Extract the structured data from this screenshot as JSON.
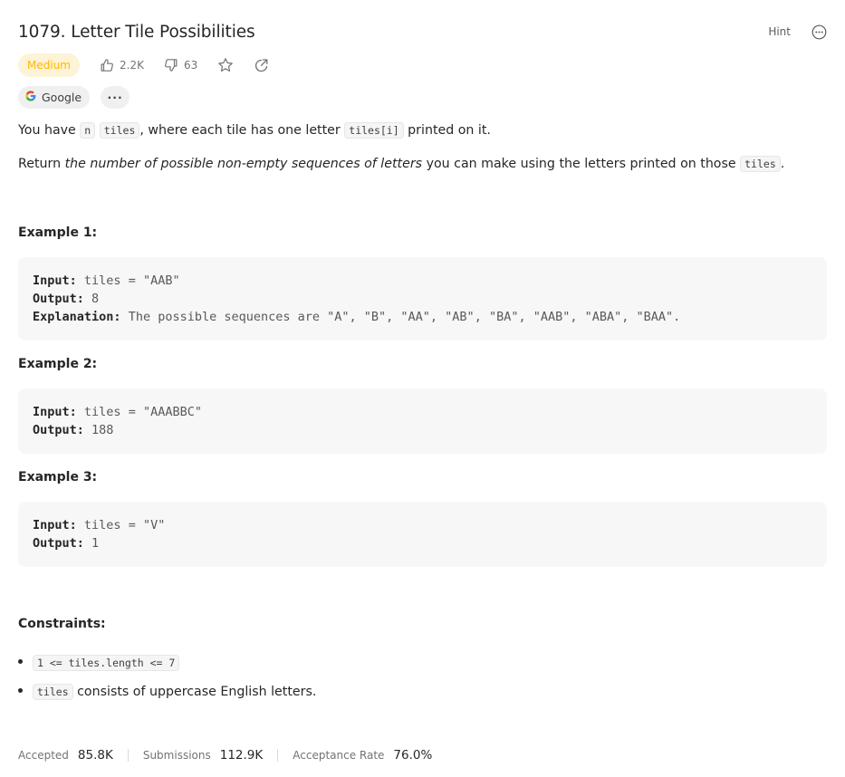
{
  "problem": {
    "title": "1079. Letter Tile Possibilities",
    "hint_label": "Hint",
    "difficulty": "Medium",
    "likes": "2.2K",
    "dislikes": "63",
    "company_tag": "Google",
    "more_tags": "···"
  },
  "description": {
    "p1": {
      "t1": "You have ",
      "c1": "n",
      "c2": "tiles",
      "t2": ", where each tile has one letter ",
      "c3": "tiles[i]",
      "t3": " printed on it."
    },
    "p2": {
      "t1": "Return ",
      "em": "the number of possible non-empty sequences of letters",
      "t2": " you can make using the letters printed on those ",
      "c1": "tiles",
      "t3": "."
    }
  },
  "examples": [
    {
      "heading": "Example 1:",
      "input_label": "Input:",
      "input": "tiles = \"AAB\"",
      "output_label": "Output:",
      "output": "8",
      "explanation_label": "Explanation:",
      "explanation": "The possible sequences are \"A\", \"B\", \"AA\", \"AB\", \"BA\", \"AAB\", \"ABA\", \"BAA\"."
    },
    {
      "heading": "Example 2:",
      "input_label": "Input:",
      "input": "tiles = \"AAABBC\"",
      "output_label": "Output:",
      "output": "188"
    },
    {
      "heading": "Example 3:",
      "input_label": "Input:",
      "input": "tiles = \"V\"",
      "output_label": "Output:",
      "output": "1"
    }
  ],
  "constraints": {
    "heading": "Constraints:",
    "c1_code": "1 <= tiles.length <= 7",
    "c2_code": "tiles",
    "c2_text": " consists of uppercase English letters."
  },
  "stats": {
    "accepted_label": "Accepted",
    "accepted": "85.8K",
    "submissions_label": "Submissions",
    "submissions": "112.9K",
    "acceptance_label": "Acceptance Rate",
    "acceptance": "76.0%"
  },
  "colors": {
    "difficulty_text": "#ffb800",
    "difficulty_bg": "#fdf3d6",
    "code_bg": "#f7f7f8"
  },
  "icons": [
    "hint-icon",
    "more-options-icon",
    "thumbs-up-icon",
    "thumbs-down-icon",
    "star-icon",
    "share-icon",
    "google-icon"
  ]
}
